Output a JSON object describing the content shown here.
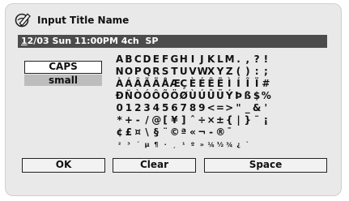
{
  "header": {
    "title": "Input Title Name",
    "icon": "pencil-edit-icon"
  },
  "name_field": {
    "cursor_char": "1",
    "value_rest": "2/03 Sun 11:00PM 4ch  SP"
  },
  "modes": {
    "caps": "CAPS",
    "small": "small"
  },
  "char_rows": [
    [
      "A",
      "B",
      "C",
      "D",
      "E",
      "F",
      "G",
      "H",
      "I",
      "J",
      "K",
      "L",
      "M",
      ".",
      ",",
      "?",
      "!"
    ],
    [
      "N",
      "O",
      "P",
      "Q",
      "R",
      "S",
      "T",
      "U",
      "V",
      "W",
      "X",
      "Y",
      "Z",
      "(",
      ")",
      ":",
      ";"
    ],
    [
      "À",
      "Á",
      "Â",
      "Ã",
      "Ä",
      "Å",
      "Æ",
      "Ç",
      "È",
      "É",
      "Ê",
      "Ë",
      "Ì",
      "Í",
      "Î",
      "Ï",
      "#"
    ],
    [
      "Ð",
      "Ñ",
      "Ò",
      "Ó",
      "Ô",
      "Õ",
      "Ö",
      "Ø",
      "Ù",
      "Ú",
      "Û",
      "Ü",
      "Ý",
      "Þ",
      "ß",
      "$",
      "%"
    ],
    [
      "0",
      "1",
      "2",
      "3",
      "4",
      "5",
      "6",
      "7",
      "8",
      "9",
      "<",
      "=",
      ">",
      "\"",
      "_",
      "&",
      "'"
    ],
    [
      "*",
      "+",
      "-",
      "/",
      "@",
      "[",
      "¥",
      "]",
      "ˆ",
      "÷",
      "×",
      "±",
      "{",
      "|",
      "}",
      "˜",
      "¡"
    ],
    [
      "¢",
      "£",
      "¤",
      "\\",
      "§",
      "¨",
      "©",
      "ª",
      "«",
      "¬",
      "-",
      "®",
      "¯",
      "",
      "",
      "",
      ""
    ],
    [
      "²",
      "³",
      "´",
      "µ",
      "¶",
      "·",
      "¸",
      "¹",
      "º",
      "»",
      "¼",
      "½",
      "¾",
      "¿",
      "`",
      "",
      ""
    ]
  ],
  "buttons": {
    "ok": "OK",
    "clear": "Clear",
    "space": "Space"
  }
}
